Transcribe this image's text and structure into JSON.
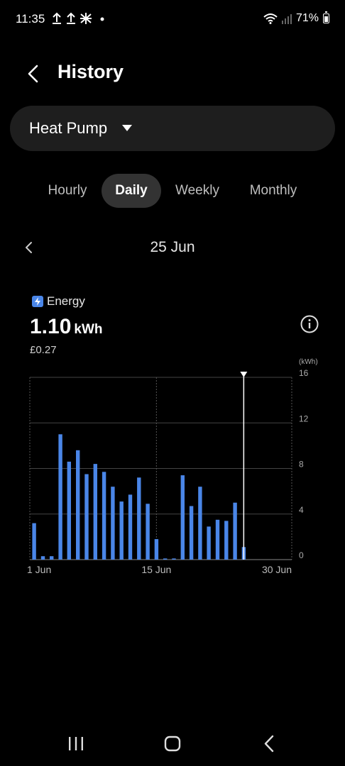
{
  "status_bar": {
    "time": "11:35",
    "left_icons": [
      "upload-icon",
      "upload-icon",
      "network-icon",
      "dot-icon"
    ],
    "battery": "71%"
  },
  "header": {
    "title": "History"
  },
  "device_selector": {
    "value": "Heat Pump"
  },
  "tabs": [
    {
      "label": "Hourly",
      "active": false
    },
    {
      "label": "Daily",
      "active": true
    },
    {
      "label": "Weekly",
      "active": false
    },
    {
      "label": "Monthly",
      "active": false
    }
  ],
  "date_nav": {
    "label": "25 Jun"
  },
  "summary": {
    "label": "Energy",
    "value": "1.10",
    "unit": "kWh",
    "cost": "£0.27"
  },
  "chart_data": {
    "type": "bar",
    "title": "",
    "xlabel": "",
    "ylabel": "(kWh)",
    "ylim": [
      0,
      16
    ],
    "y_ticks": [
      "16",
      "12",
      "8",
      "4",
      "0"
    ],
    "x_tick_labels": [
      "1 Jun",
      "15 Jun",
      "30 Jun"
    ],
    "x": [
      1,
      2,
      3,
      4,
      5,
      6,
      7,
      8,
      9,
      10,
      11,
      12,
      13,
      14,
      15,
      16,
      17,
      18,
      19,
      20,
      21,
      22,
      23,
      24,
      25,
      26,
      27,
      28,
      29,
      30
    ],
    "values": [
      3.2,
      0.3,
      0.3,
      11.0,
      8.6,
      9.6,
      7.5,
      8.4,
      7.7,
      6.4,
      5.1,
      5.7,
      7.2,
      4.9,
      1.8,
      0.1,
      0.1,
      7.4,
      4.7,
      6.4,
      2.9,
      3.5,
      3.4,
      5.0,
      1.1,
      0,
      0,
      0,
      0,
      0
    ],
    "selected_day": 25,
    "bar_color": "#4a86e8"
  },
  "nav_bar": {
    "items": [
      "recents-icon",
      "home-icon",
      "back-icon"
    ]
  }
}
